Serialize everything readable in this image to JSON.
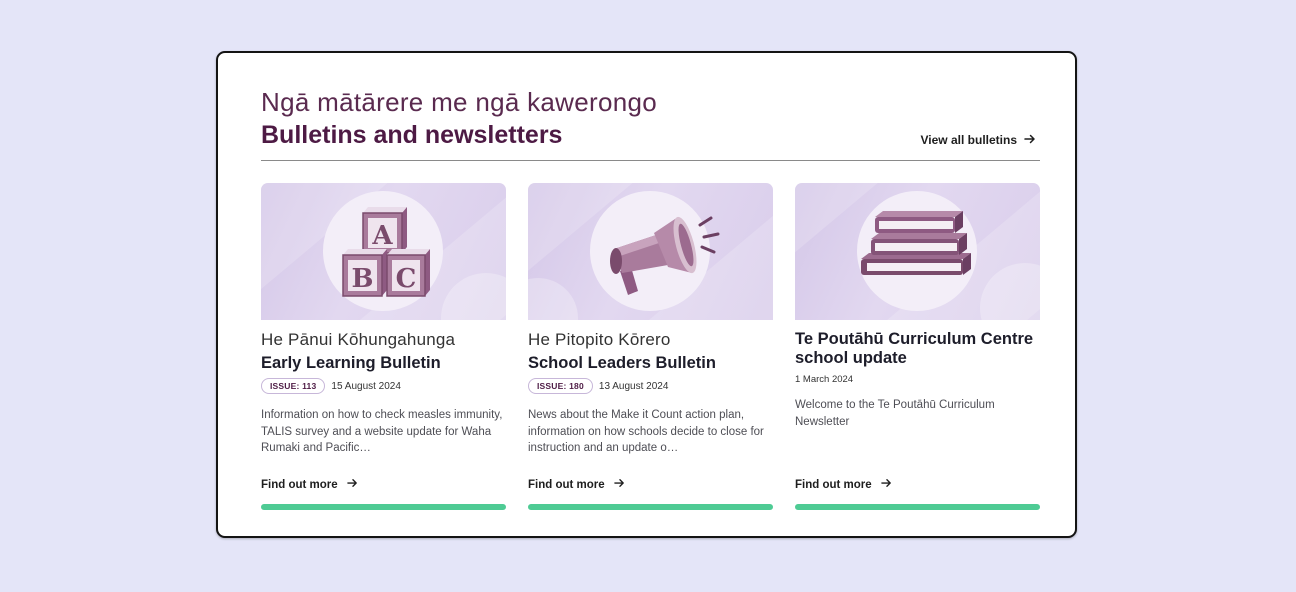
{
  "colors": {
    "page_bg": "#e4e5f8",
    "heading_plum": "#4d1a44",
    "accent_green": "#4ecb94",
    "image_lilac": "#d4c7e8"
  },
  "header": {
    "maori_title": "Ngā mātārere me ngā kawerongo",
    "title": "Bulletins and newsletters",
    "view_all": "View all bulletins",
    "view_all_icon": "arrow-right-icon"
  },
  "cards": [
    {
      "image_icon": "abc-blocks-icon",
      "subtitle": "He Pānui Kōhungahunga",
      "title": "Early Learning Bulletin",
      "issue": "ISSUE: 113",
      "date": "15 August 2024",
      "description": "Information on how to check measles immunity, TALIS survey and a website update for Waha Rumaki and Pacific…",
      "link": "Find out more"
    },
    {
      "image_icon": "megaphone-icon",
      "subtitle": "He Pitopito Kōrero",
      "title": "School Leaders Bulletin",
      "issue": "ISSUE: 180",
      "date": "13 August 2024",
      "description": "News about the Make it Count action plan, information on how schools decide to close for instruction and an update o…",
      "link": "Find out more"
    },
    {
      "image_icon": "books-stack-icon",
      "subtitle": "",
      "title": "Te Poutāhū Curriculum Centre school update",
      "issue": "",
      "date": "1 March 2024",
      "description": "Welcome to the Te Poutāhū Curriculum Newsletter",
      "link": "Find out more"
    }
  ]
}
